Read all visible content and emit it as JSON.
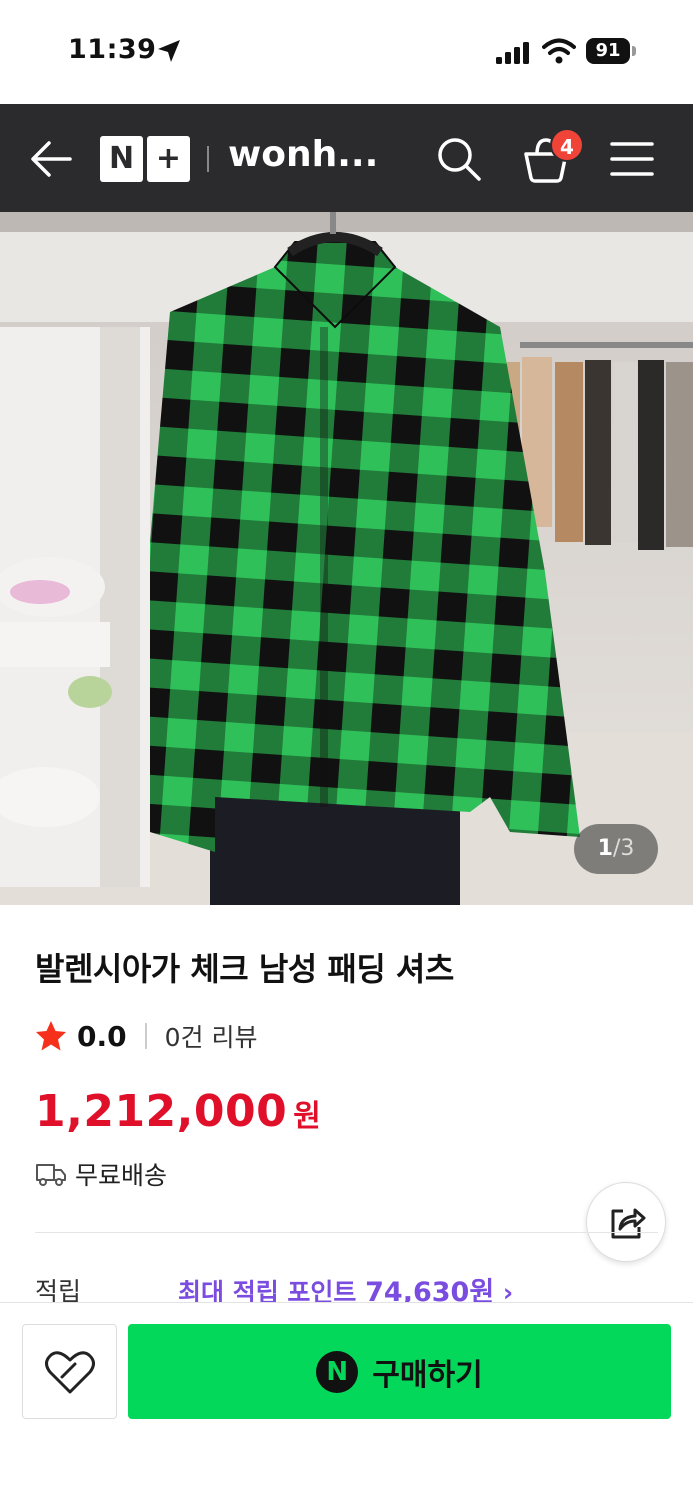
{
  "status_bar": {
    "time": "11:39",
    "battery": "91"
  },
  "nav": {
    "logo_left": "N",
    "logo_right": "+",
    "store_name": "wonh...",
    "cart_count": "4"
  },
  "image": {
    "current": "1",
    "separator": "/",
    "total": "3"
  },
  "product": {
    "title": "발렌시아가 체크 남성 패딩 셔츠",
    "rating": "0.0",
    "review_count": "0건 리뷰",
    "price": "1,212,000",
    "price_unit": "원",
    "shipping": "무료배송"
  },
  "points": {
    "label": "적립",
    "prefix": "최대 적립 포인트 ",
    "value": "74,630원",
    "chevron": " ›"
  },
  "bottom": {
    "npay_mark": "N",
    "buy_label": "구매하기"
  },
  "icons": {
    "back": "back-arrow-icon",
    "search": "search-icon",
    "cart": "cart-icon",
    "menu": "menu-icon",
    "star": "star-icon",
    "truck": "truck-icon",
    "share": "share-icon",
    "wish": "heart-icon"
  },
  "colors": {
    "nav_bg": "#2b2b2d",
    "price": "#e0102b",
    "points": "#7a4ce0",
    "buy_button": "#03d85a",
    "badge": "#f04438",
    "star": "#f5301b"
  }
}
